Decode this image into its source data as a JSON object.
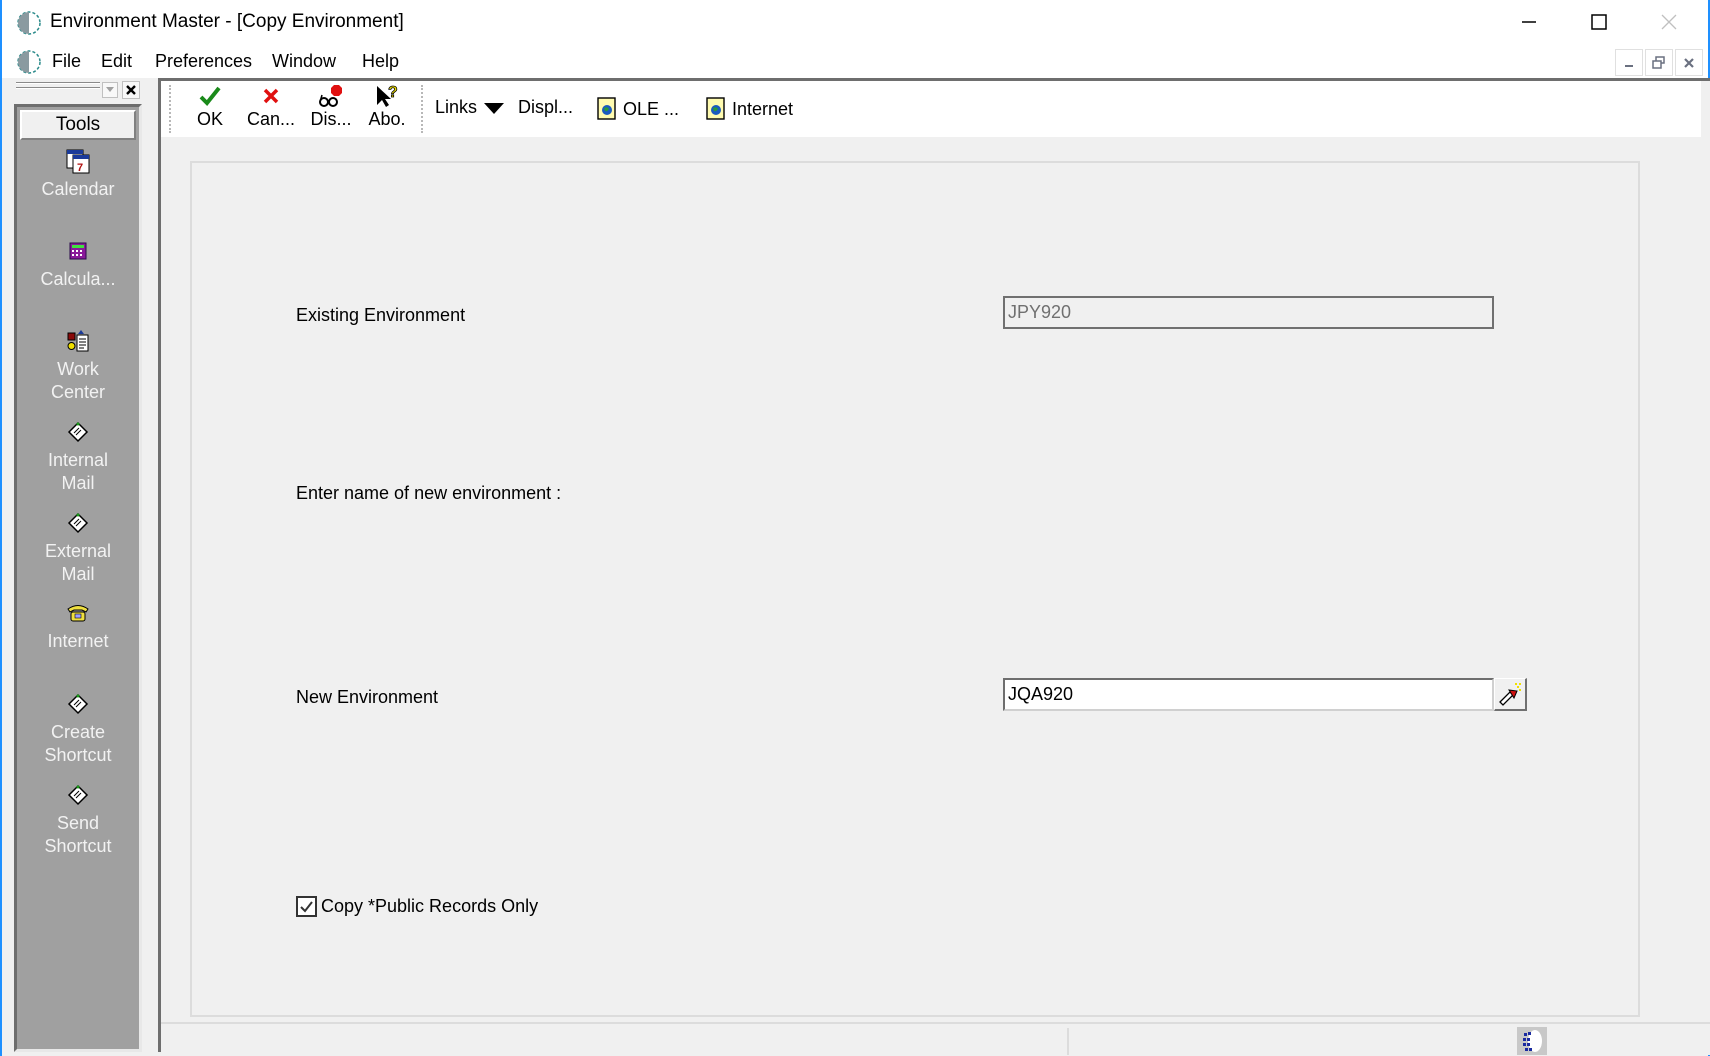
{
  "window": {
    "title": "Environment Master - [Copy Environment]",
    "controls": {
      "minimize": "minimize",
      "maximize": "maximize",
      "close": "close"
    }
  },
  "menubar": {
    "items": [
      "File",
      "Edit",
      "Preferences",
      "Window",
      "Help"
    ],
    "mdi_controls": [
      "minimize",
      "restore",
      "close"
    ]
  },
  "tools": {
    "header": "Tools",
    "items": [
      {
        "label": "Calendar",
        "icon": "calendar-icon"
      },
      {
        "label": "Calcula...",
        "icon": "calculator-icon"
      },
      {
        "label_line1": "Work",
        "label_line2": "Center",
        "icon": "work-center-icon"
      },
      {
        "label_line1": "Internal",
        "label_line2": "Mail",
        "icon": "mail-icon"
      },
      {
        "label_line1": "External",
        "label_line2": "Mail",
        "icon": "mail-icon"
      },
      {
        "label": "Internet",
        "icon": "telephone-icon"
      },
      {
        "label_line1": "Create",
        "label_line2": "Shortcut",
        "icon": "shortcut-icon"
      },
      {
        "label_line1": "Send",
        "label_line2": "Shortcut",
        "icon": "shortcut-icon"
      }
    ]
  },
  "toolbar": {
    "ok": "OK",
    "cancel": "Can...",
    "display": "Dis...",
    "about": "Abo.",
    "links": "Links",
    "display_links": "Displ...",
    "ole": "OLE ...",
    "internet": "Internet"
  },
  "form": {
    "existing_label": "Existing Environment",
    "existing_value": "JPY920",
    "prompt_label": "Enter name of new environment :",
    "new_label": "New Environment",
    "new_value": "JQA920",
    "checkbox_label": "Copy *Public Records Only",
    "checkbox_checked": true
  },
  "colors": {
    "accent_border": "#1e90ff",
    "tools_panel": "#a0a0a0",
    "ok_green": "#1a8a1a",
    "cancel_red": "#e01010"
  }
}
